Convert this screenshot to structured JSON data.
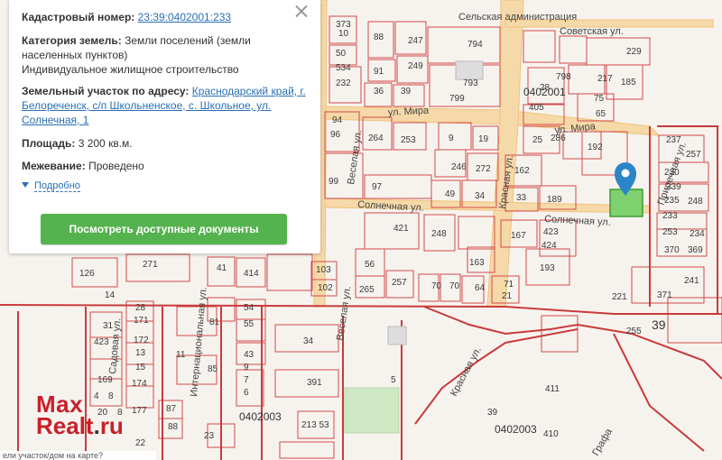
{
  "panel": {
    "cadastral_label": "Кадастровый номер:",
    "cadastral_value": "23:39:0402001:233",
    "category_label": "Категория земель:",
    "category_value": "Земли поселений (земли населенных пунктов)",
    "use_value": "Индивидуальное жилищное строительство",
    "address_label": "Земельный участок по адресу:",
    "address_value": "Краснодарский край, г. Белореченск, с/п Школьненское, с. Школьное, ул. Солнечная, 1",
    "area_label": "Площадь:",
    "area_value": "3 200 кв.м.",
    "survey_label": "Межевание:",
    "survey_value": "Проведено",
    "more_label": "Подробно",
    "button_label": "Посмотреть доступные документы"
  },
  "map": {
    "streets": {
      "sovetskaya": "Советская ул.",
      "mira": "ул. Мира",
      "mira_west": "ул. Мира",
      "solnechnaya_w": "Солнечная ул.",
      "solnechnaya_e": "Солнечная ул.",
      "krasnaya_n": "Красная ул.",
      "krasnaya_s": "Красная ул.",
      "veselaya_n": "Веселая ул.",
      "veselaya_s": "Веселая ул.",
      "internatsionalnaya": "Интернациональная ул.",
      "priyutnaya": "Приречная ул.",
      "sadovaya": "Садовая ул.",
      "admin": "Сельская администрация",
      "ramp": "Графа"
    },
    "quarters": [
      "0402001",
      "0402003",
      "0402003"
    ],
    "big_numbers": [
      "39",
      "5",
      "39",
      "34",
      "391"
    ],
    "plot_numbers": [
      {
        "t": "373",
        "c": "tl1"
      },
      {
        "t": "10",
        "c": "a1"
      },
      {
        "t": "88",
        "c": "a2"
      },
      {
        "t": "247",
        "c": "a3"
      },
      {
        "t": "794",
        "c": "a4"
      },
      {
        "t": "50",
        "c": "a5"
      },
      {
        "t": "534",
        "c": "a6"
      },
      {
        "t": "91",
        "c": "a7"
      },
      {
        "t": "249",
        "c": "a8"
      },
      {
        "t": "793",
        "c": "a9"
      },
      {
        "t": "232",
        "c": "a10"
      },
      {
        "t": "36",
        "c": "a11"
      },
      {
        "t": "39",
        "c": "a12"
      },
      {
        "t": "799",
        "c": "a13"
      },
      {
        "t": "798",
        "c": "a14"
      },
      {
        "t": "217",
        "c": "a15"
      },
      {
        "t": "229",
        "c": "a16"
      },
      {
        "t": "185",
        "c": "a17"
      },
      {
        "t": "75",
        "c": "a18"
      },
      {
        "t": "405",
        "c": "a19"
      },
      {
        "t": "28",
        "c": "a20"
      },
      {
        "t": "65",
        "c": "a21"
      },
      {
        "t": "94",
        "c": "a22"
      },
      {
        "t": "96",
        "c": "a23"
      },
      {
        "t": "264",
        "c": "a24"
      },
      {
        "t": "253",
        "c": "a25"
      },
      {
        "t": "9",
        "c": "a26"
      },
      {
        "t": "19",
        "c": "a27"
      },
      {
        "t": "25",
        "c": "a28"
      },
      {
        "t": "286",
        "c": "a29"
      },
      {
        "t": "192",
        "c": "a30"
      },
      {
        "t": "246",
        "c": "a31"
      },
      {
        "t": "272",
        "c": "a32"
      },
      {
        "t": "162",
        "c": "a33"
      },
      {
        "t": "237",
        "c": "a34"
      },
      {
        "t": "257",
        "c": "a35"
      },
      {
        "t": "230",
        "c": "a36"
      },
      {
        "t": "99",
        "c": "a37"
      },
      {
        "t": "97",
        "c": "a38"
      },
      {
        "t": "49",
        "c": "a39"
      },
      {
        "t": "34",
        "c": "a40"
      },
      {
        "t": "33",
        "c": "a41"
      },
      {
        "t": "189",
        "c": "a42"
      },
      {
        "t": "239",
        "c": "a43"
      },
      {
        "t": "235",
        "c": "a44"
      },
      {
        "t": "248",
        "c": "a45"
      },
      {
        "t": "233",
        "c": "a46"
      },
      {
        "t": "421",
        "c": "a47"
      },
      {
        "t": "248",
        "c": "a48"
      },
      {
        "t": "167",
        "c": "a49"
      },
      {
        "t": "423",
        "c": "a50"
      },
      {
        "t": "424",
        "c": "a51"
      },
      {
        "t": "253",
        "c": "a52"
      },
      {
        "t": "370",
        "c": "a53"
      },
      {
        "t": "234",
        "c": "a54"
      },
      {
        "t": "369",
        "c": "a55"
      },
      {
        "t": "271",
        "c": "a56"
      },
      {
        "t": "41",
        "c": "a57"
      },
      {
        "t": "414",
        "c": "a58"
      },
      {
        "t": "56",
        "c": "a59"
      },
      {
        "t": "163",
        "c": "a60"
      },
      {
        "t": "193",
        "c": "a61"
      },
      {
        "t": "103",
        "c": "a62"
      },
      {
        "t": "102",
        "c": "a63"
      },
      {
        "t": "265",
        "c": "a64"
      },
      {
        "t": "257",
        "c": "a65"
      },
      {
        "t": "70",
        "c": "a66"
      },
      {
        "t": "70",
        "c": "a67"
      },
      {
        "t": "64",
        "c": "a68"
      },
      {
        "t": "71",
        "c": "a69"
      },
      {
        "t": "21",
        "c": "a70"
      },
      {
        "t": "241",
        "c": "a71"
      },
      {
        "t": "371",
        "c": "a72"
      },
      {
        "t": "221",
        "c": "a73"
      },
      {
        "t": "126",
        "c": "a74"
      },
      {
        "t": "14",
        "c": "a75"
      },
      {
        "t": "54",
        "c": "a76"
      },
      {
        "t": "28",
        "c": "a77"
      },
      {
        "t": "171",
        "c": "a78"
      },
      {
        "t": "81",
        "c": "a79"
      },
      {
        "t": "55",
        "c": "a80"
      },
      {
        "t": "31",
        "c": "a81"
      },
      {
        "t": "172",
        "c": "a82"
      },
      {
        "t": "423",
        "c": "a83"
      },
      {
        "t": "13",
        "c": "a84"
      },
      {
        "t": "11",
        "c": "a85"
      },
      {
        "t": "43",
        "c": "a86"
      },
      {
        "t": "15",
        "c": "a87"
      },
      {
        "t": "85",
        "c": "a88"
      },
      {
        "t": "169",
        "c": "a89"
      },
      {
        "t": "174",
        "c": "a90"
      },
      {
        "t": "177",
        "c": "a91"
      },
      {
        "t": "87",
        "c": "a92"
      },
      {
        "t": "88",
        "c": "a93"
      },
      {
        "t": "22",
        "c": "a94"
      },
      {
        "t": "23",
        "c": "a95"
      },
      {
        "t": "213 53",
        "c": "a96"
      },
      {
        "t": "255",
        "c": "a97"
      },
      {
        "t": "411",
        "c": "a98"
      },
      {
        "t": "410",
        "c": "a99"
      },
      {
        "t": "9",
        "c": "a100"
      },
      {
        "t": "7",
        "c": "a101"
      },
      {
        "t": "6",
        "c": "a102"
      },
      {
        "t": "4",
        "c": "a103"
      },
      {
        "t": "8",
        "c": "a104"
      },
      {
        "t": "20",
        "c": "a105"
      },
      {
        "t": "8",
        "c": "a106"
      }
    ]
  },
  "logo": {
    "line1": "Max",
    "line2a": "Realt",
    "dot": ".",
    "line2b": "ru"
  },
  "bottom_text": "ели участок/дом на карте?",
  "colors": {
    "parcel": "#d24a4a",
    "road": "#f4c68a",
    "highlight": "#7fd06e",
    "pin": "#2a86c8",
    "button": "#55b34f"
  }
}
